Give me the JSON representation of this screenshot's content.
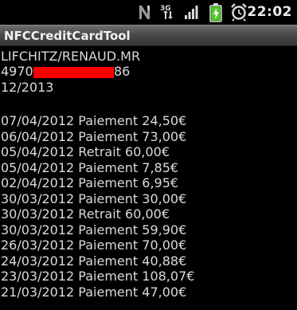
{
  "status_bar": {
    "time": "22:02",
    "icons": [
      "nfc-icon",
      "3g-data-icon",
      "signal-strength-icon",
      "battery-charging-icon",
      "alarm-icon"
    ],
    "network_label": "3G"
  },
  "app": {
    "title": "NFCCreditCardTool"
  },
  "card": {
    "holder": "LIFCHITZ/RENAUD.MR",
    "number_prefix": "4970",
    "number_suffix": "86",
    "expiry": "12/2013"
  },
  "transactions": [
    "07/04/2012 Paiement 24,50€",
    "06/04/2012 Paiement 73,00€",
    "05/04/2012 Retrait 60,00€",
    "05/04/2012 Paiement 7,85€",
    "02/04/2012 Paiement 6,95€",
    "30/03/2012 Paiement 30,00€",
    "30/03/2012 Retrait 60,00€",
    "30/03/2012 Paiement 59,90€",
    "26/03/2012 Paiement 70,00€",
    "24/03/2012 Paiement 40,88€",
    "23/03/2012 Paiement 108,07€",
    "21/03/2012 Paiement 47,00€"
  ],
  "colors": {
    "background": "#000000",
    "text": "#dadada",
    "redaction": "#ff0000",
    "title_bar": "#4a4a4a"
  }
}
